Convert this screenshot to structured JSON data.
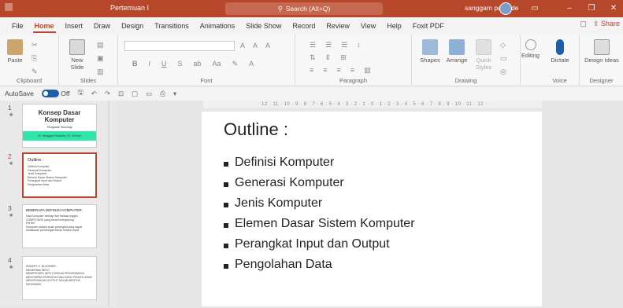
{
  "app": {
    "title": "Pertemuan I",
    "search_placeholder": "Search (Alt+Q)",
    "user": "sanggam pardede"
  },
  "menu": {
    "tabs": [
      "File",
      "Home",
      "Insert",
      "Draw",
      "Design",
      "Transitions",
      "Animations",
      "Slide Show",
      "Record",
      "Review",
      "View",
      "Help",
      "Foxit PDF"
    ],
    "active": "Home",
    "share": "Share"
  },
  "ribbon": {
    "groups": [
      "Clipboard",
      "Slides",
      "Font",
      "Paragraph",
      "Drawing",
      "Voice",
      "Designer"
    ],
    "paste": "Paste",
    "new_slide": "New Slide",
    "shapes": "Shapes",
    "arrange": "Arrange",
    "quick_styles": "Quick Styles",
    "editing": "Editing",
    "dictate": "Dictate",
    "design_ideas": "Design Ideas"
  },
  "quickbar": {
    "autosave": "AutoSave",
    "autosave_state": "Off"
  },
  "thumbnails": [
    {
      "num": "1",
      "title": "Konsep Dasar Komputer",
      "subtitle": "Pengantar Teknologi",
      "banner": "Dr. Sanggam Pardede, ST., M.Kom"
    },
    {
      "num": "2",
      "title": "Outline :",
      "items": [
        "Definisi Komputer",
        "Generasi Komputer",
        "Jenis Komputer",
        "Elemen Dasar Sistem Komputer",
        "Perangkat Input dan Output",
        "Pengolahan Data"
      ]
    },
    {
      "num": "3",
      "title": "BEBERAPA DEFINISI KOMPUTER:",
      "items": [
        "Kata komputer diserap dari bahasa Inggris COMPUTARE yang berarti menghitung",
        "FAHMI",
        "Komputer adalah suatu perangkat yang dapat melakukan perhitungan besar secara cepat"
      ]
    },
    {
      "num": "4",
      "items": [
        "ROBERT H. BLISSMER :",
        "MENERIMA INPUT",
        "MEMPROSES INPUT SESUAI PROGRAMNYA",
        "MENYIMPAN PERINTAH DAN HASIL PENGOLAHAN",
        "MENYEDIAKAN OUTPUT DALAM BENTUK INFORMASI"
      ]
    }
  ],
  "slide": {
    "title": "Outline :",
    "items": [
      "Definisi Komputer",
      "Generasi Komputer",
      "Jenis Komputer",
      "Elemen Dasar Sistem Komputer",
      "Perangkat Input dan Output",
      "Pengolahan Data"
    ]
  },
  "ruler": "· 12 · 11 · 10 · 9 · 8 · 7 · 6 · 5 · 4 · 3 · 2 · 1 · 0 · 1 · 2 · 3 · 4 · 5 · 6 · 7 · 8 · 9 · 10 · 11 · 12 ·",
  "colors": {
    "accent": "#b7472a",
    "banner": "#2ee6a8"
  }
}
